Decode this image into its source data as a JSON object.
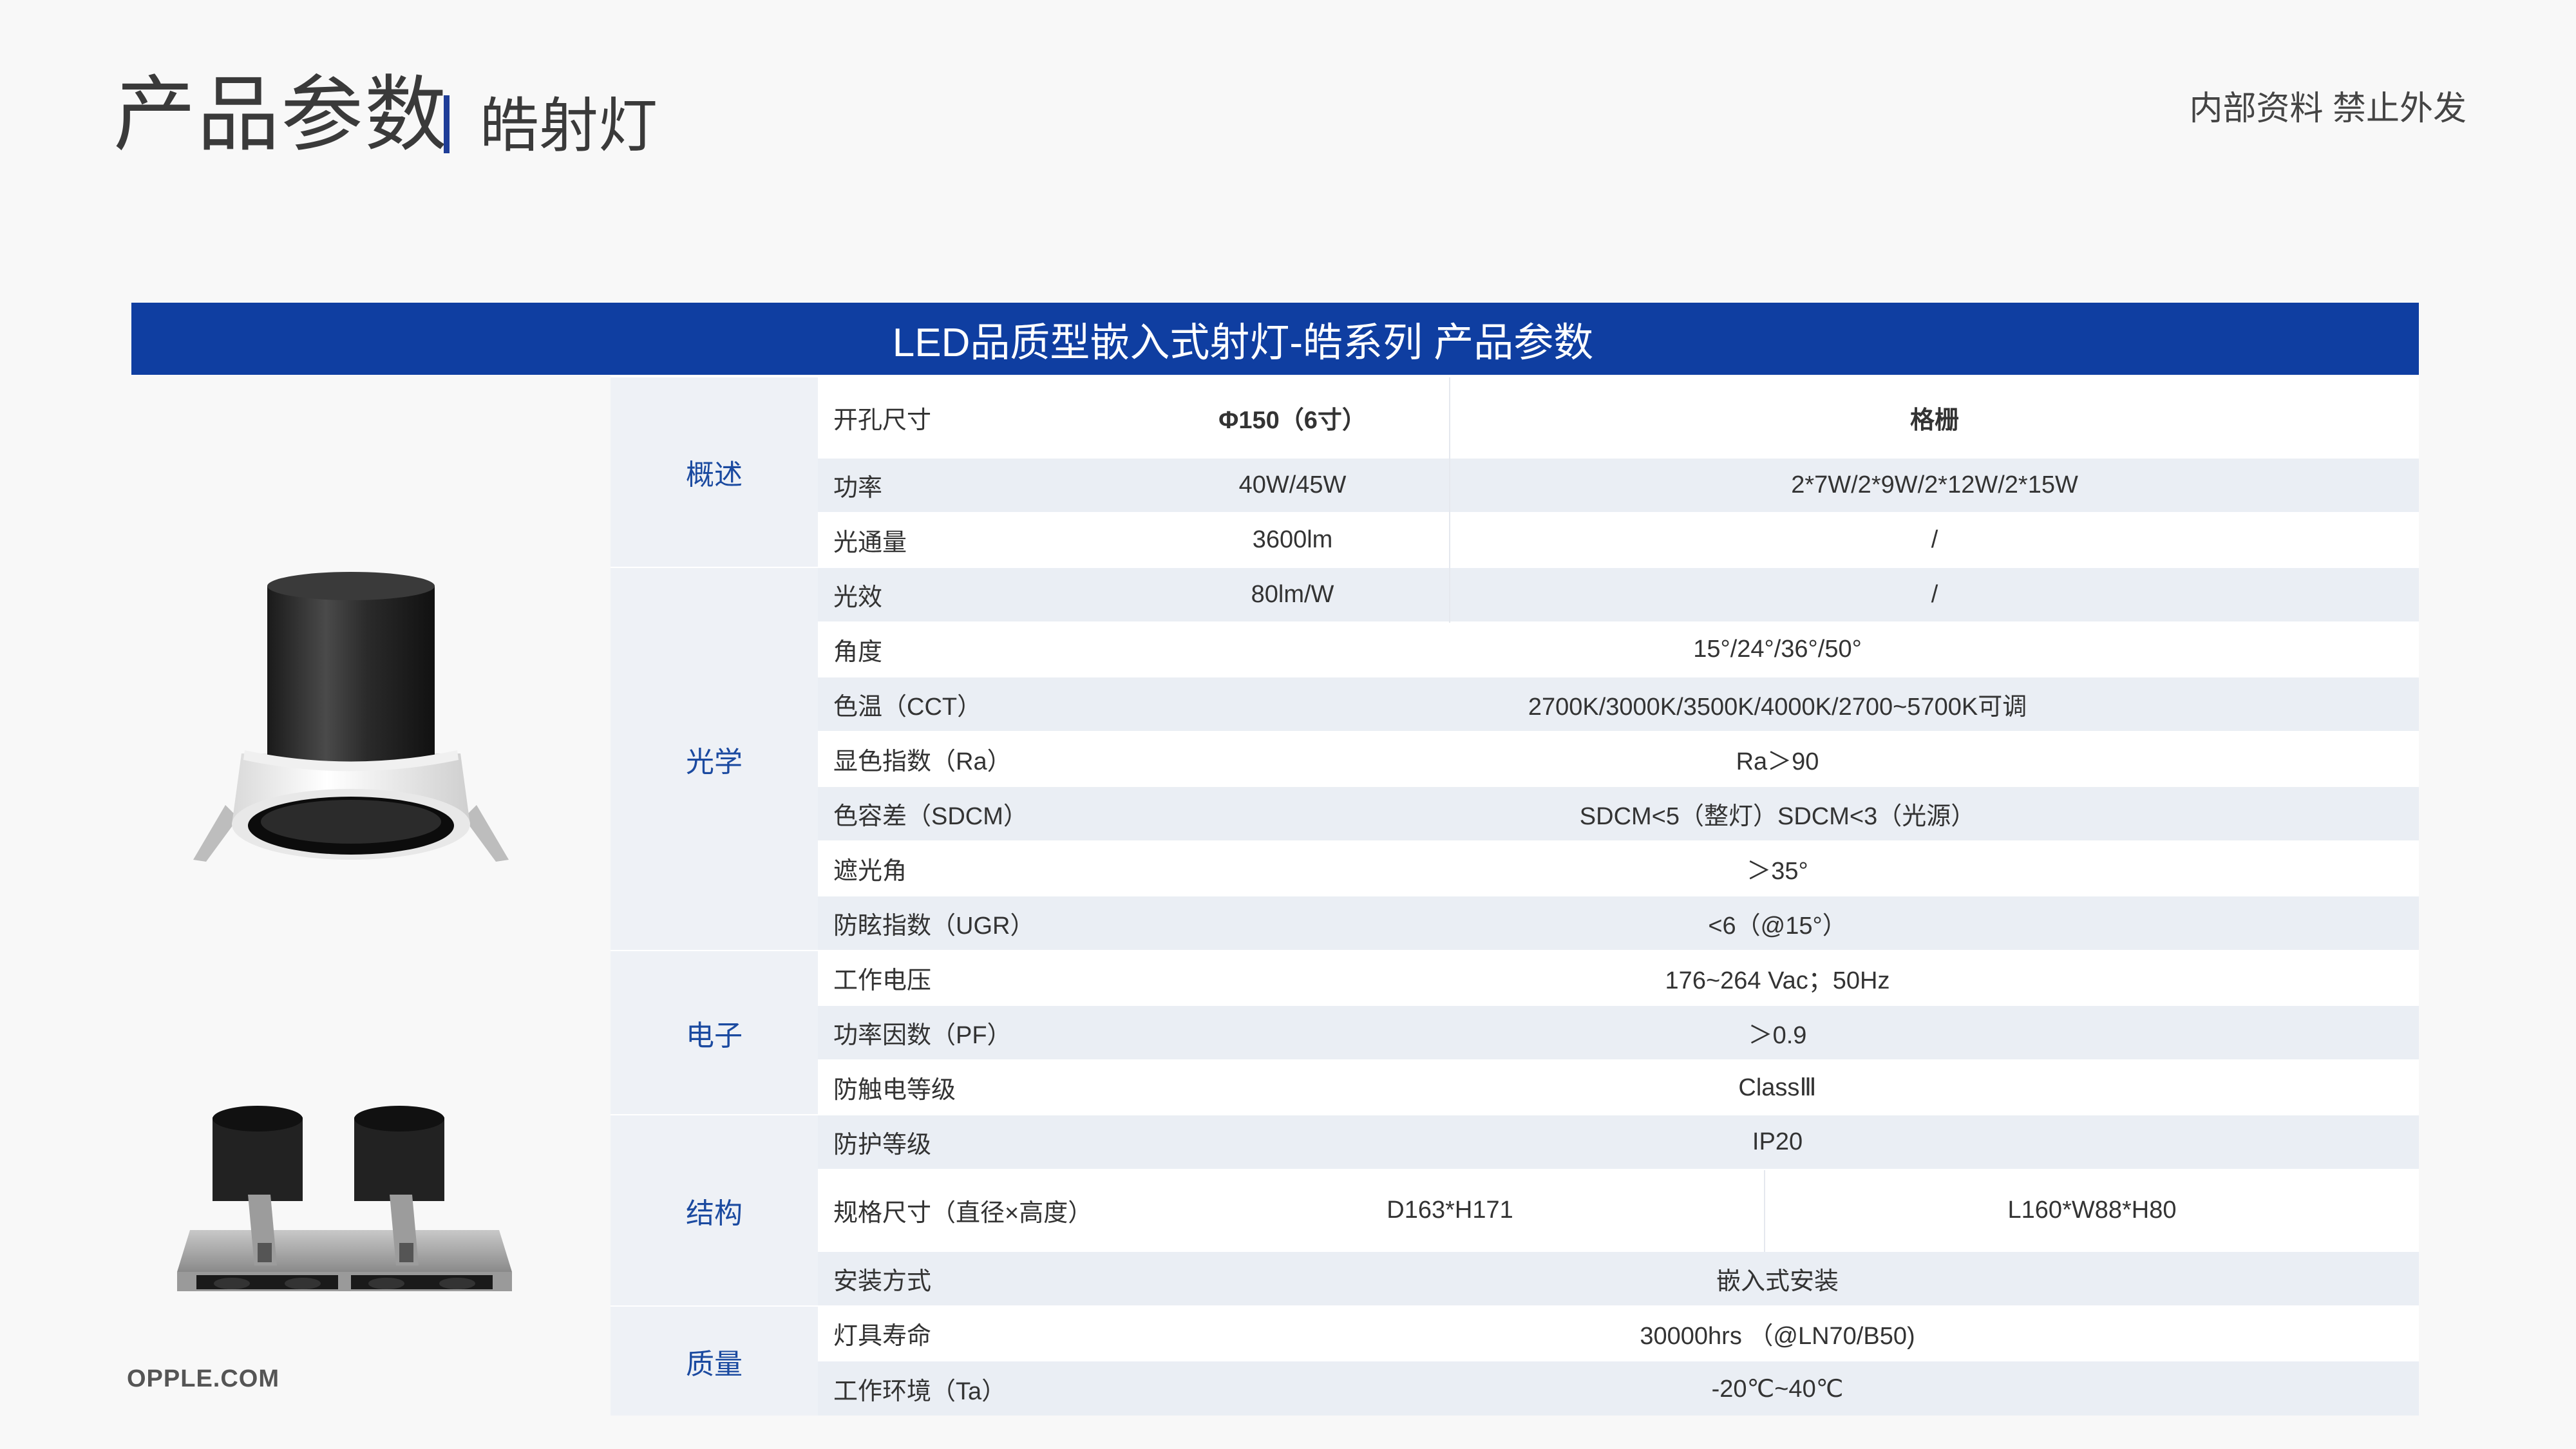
{
  "header": {
    "title": "产品参数",
    "subtitle": "皓射灯",
    "confidential": "内部资料 禁止外发"
  },
  "banner": {
    "title": "LED品质型嵌入式射灯-皓系列 产品参数"
  },
  "footer": {
    "site": "OPPLE.COM"
  },
  "colors": {
    "brand_blue": "#0f3ea1",
    "category_text": "#1b4aa0",
    "row_gray": "#eaeef4"
  },
  "categories": {
    "overview": "概述",
    "optics": "光学",
    "electrical": "电子",
    "structure": "结构",
    "quality": "质量"
  },
  "rows": {
    "cutout": {
      "label": "开孔尺寸",
      "v1": "Φ150（6寸）",
      "v2": "格栅"
    },
    "power": {
      "label": "功率",
      "v1": "40W/45W",
      "v2": "2*7W/2*9W/2*12W/2*15W"
    },
    "flux": {
      "label": "光通量",
      "v1": "3600lm",
      "v2": "/"
    },
    "efficacy": {
      "label": "光效",
      "v1": "80lm/W",
      "v2": "/"
    },
    "angle": {
      "label": "角度",
      "value": "15°/24°/36°/50°"
    },
    "cct": {
      "label": "色温（CCT）",
      "value": "2700K/3000K/3500K/4000K/2700~5700K可调"
    },
    "cri": {
      "label": "显色指数（Ra）",
      "value": "Ra＞90"
    },
    "sdcm": {
      "label": "色容差（SDCM）",
      "value": "SDCM<5（整灯）SDCM<3（光源）"
    },
    "shielding": {
      "label": "遮光角",
      "value": "＞35°"
    },
    "ugr": {
      "label": "防眩指数（UGR）",
      "value": "<6（@15°）"
    },
    "voltage": {
      "label": "工作电压",
      "value": "176~264 Vac；50Hz"
    },
    "pf": {
      "label": "功率因数（PF）",
      "value": "＞0.9"
    },
    "shock": {
      "label": "防触电等级",
      "value": "ClassⅢ"
    },
    "ip": {
      "label": "防护等级",
      "value": "IP20"
    },
    "size": {
      "label": "规格尺寸（直径×高度）",
      "v1": "D163*H171",
      "v2": "L160*W88*H80"
    },
    "install": {
      "label": "安装方式",
      "value": "嵌入式安装"
    },
    "lifetime": {
      "label": "灯具寿命",
      "value": "30000hrs （@LN70/B50)"
    },
    "env": {
      "label": "工作环境（Ta）",
      "value": "-20℃~40℃"
    }
  }
}
